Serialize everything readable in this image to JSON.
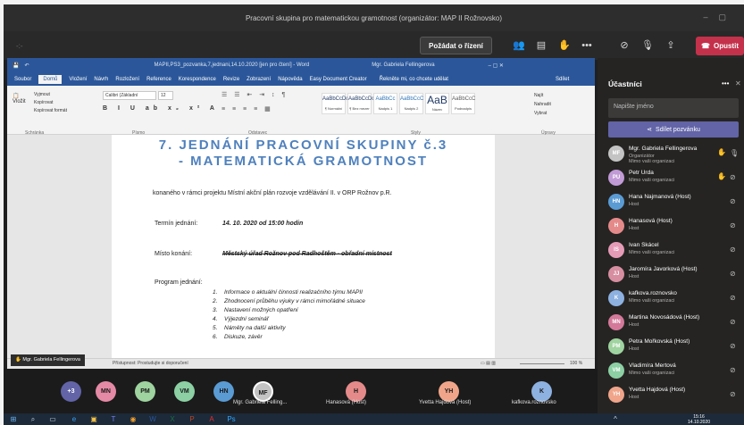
{
  "teams": {
    "title": "Pracovní skupina pro matematickou gramotnost (organizátor: MAP II Rožnovsko)",
    "toolbar": {
      "left_text": "-:-",
      "request_control": "Požádat o řízení",
      "leave": "Opustit"
    }
  },
  "word": {
    "title": "MAPII,PS3_pozvanka,7,jednani,14.10.2020 [jen pro čtení] - Word",
    "user": "Mgr. Gabriela Fellingerova",
    "tabs": [
      "Soubor",
      "Domů",
      "Vložení",
      "Návrh",
      "Rozložení",
      "Reference",
      "Korespondence",
      "Revize",
      "Zobrazení",
      "Nápověda",
      "Easy Document Creator"
    ],
    "tell_me": "Řekněte mi, co chcete udělat",
    "share": "Sdílet",
    "ribbon": {
      "paste": "Vložit",
      "cut": "Vyjmout",
      "copy": "Kopírovat",
      "format_painter": "Kopírovat formát",
      "font_name": "Calibri (Základní",
      "font_size": "12",
      "find": "Najít",
      "replace": "Nahradit",
      "select": "Vybrat",
      "groups": [
        "Schránka",
        "Písmo",
        "Odstavec",
        "Styly",
        "Úpravy"
      ],
      "styles": [
        {
          "sample": "AaBbCcDc",
          "name": "¶ Normální"
        },
        {
          "sample": "AaBbCcDc",
          "name": "¶ Bez mezer"
        },
        {
          "sample": "AaBbCc",
          "name": "Nadpis 1"
        },
        {
          "sample": "AaBbCcC",
          "name": "Nadpis 2"
        },
        {
          "sample": "AaB",
          "name": "Název"
        },
        {
          "sample": "AaBbCcC",
          "name": "Podnadpis"
        }
      ]
    },
    "document": {
      "heading1": "7. JEDNÁNÍ PRACOVNÍ SKUPINY č.3",
      "heading2": "- MATEMATICKÁ GRAMOTNOST",
      "intro": "konaného v rámci projektu Místní akční plán rozvoje vzdělávání II. v ORP Rožnov p.R.",
      "date_label": "Termín jednání:",
      "date_value": "14. 10. 2020 od 15:00 hodin",
      "place_label": "Místo konání:",
      "place_value": "Městský úřad Rožnov pod Radhoštěm - obřadní místnost",
      "program_label": "Program jednání:",
      "program": [
        "Informace o aktuální činnosti realizačního týmu MAPII",
        "Zhodnocení průběhu výuky v rámci mimořádné situace",
        "Nastavení možných opatření",
        "Výjezdní seminář",
        "Náměty na další aktivity",
        "Diskuze, závěr"
      ]
    },
    "status": {
      "accessibility": "Přístupnost: Prostudujte si doporučení",
      "zoom": "100 %"
    }
  },
  "presenter_chip": "Mgr. Gabriela Fellingerova",
  "participants": {
    "title": "Účastníci",
    "search_placeholder": "Napište jméno",
    "invite": "Sdílet pozvánku",
    "list": [
      {
        "initials": "MF",
        "name": "Mgr. Gabriela Fellingerova",
        "role": "Organizátor",
        "role2": "Mimo vaši organizaci",
        "color": "#c3c3c3",
        "hand": true,
        "mic": "on"
      },
      {
        "initials": "PU",
        "name": "Petr Urda",
        "role": "Mimo vaši organizaci",
        "color": "#c19bd6",
        "hand": true,
        "mic": "off"
      },
      {
        "initials": "HN",
        "name": "Hana Najmanová (Host)",
        "role": "Host",
        "color": "#5a9bd4",
        "hand": false,
        "mic": "off"
      },
      {
        "initials": "H",
        "name": "Hanasová (Host)",
        "role": "Host",
        "color": "#e58a8a",
        "hand": false,
        "mic": "off"
      },
      {
        "initials": "IS",
        "name": "Ivan Skácel",
        "role": "Mimo vaši organizaci",
        "color": "#e59bb6",
        "hand": false,
        "mic": "off"
      },
      {
        "initials": "JJ",
        "name": "Jaromíra Javorková (Host)",
        "role": "Host",
        "color": "#d68ea0",
        "hand": false,
        "mic": "off"
      },
      {
        "initials": "K",
        "name": "kafkova.roznovsko",
        "role": "Mimo vaši organizaci",
        "color": "#8db1e0",
        "hand": false,
        "mic": "off"
      },
      {
        "initials": "MN",
        "name": "Martina Novosádová (Host)",
        "role": "Host",
        "color": "#d4799a",
        "hand": false,
        "mic": "off"
      },
      {
        "initials": "PM",
        "name": "Petra Mořkovská (Host)",
        "role": "Host",
        "color": "#9fd3a0",
        "hand": false,
        "mic": "off"
      },
      {
        "initials": "VM",
        "name": "Vladimíra Mertová",
        "role": "Mimo vaši organizaci",
        "color": "#8cd0a4",
        "hand": false,
        "mic": "off"
      },
      {
        "initials": "YH",
        "name": "Yvetta Hajdová (Host)",
        "role": "Host",
        "color": "#f0a58a",
        "hand": false,
        "mic": "off"
      }
    ]
  },
  "strip": {
    "more": "+3",
    "avatars": [
      {
        "initials": "MN",
        "color": "#e58aa6",
        "label": ""
      },
      {
        "initials": "PM",
        "color": "#9fd3a0",
        "label": ""
      },
      {
        "initials": "VM",
        "color": "#8cd0a4",
        "label": ""
      },
      {
        "initials": "HN",
        "color": "#5a9bd4",
        "label": ""
      },
      {
        "initials": "MF",
        "color": "#c3c3c3",
        "label": "Mgr. Gabriela Felling..."
      },
      {
        "initials": "H",
        "color": "#e58a8a",
        "label": "Hanasová (Host)"
      },
      {
        "initials": "YH",
        "color": "#f0a58a",
        "label": "Yvetta Hajdová (Host)"
      },
      {
        "initials": "K",
        "color": "#8db1e0",
        "label": "kafkova.roznovsko"
      }
    ]
  },
  "taskbar": {
    "time": "15:16",
    "date": "14.10.2020"
  }
}
